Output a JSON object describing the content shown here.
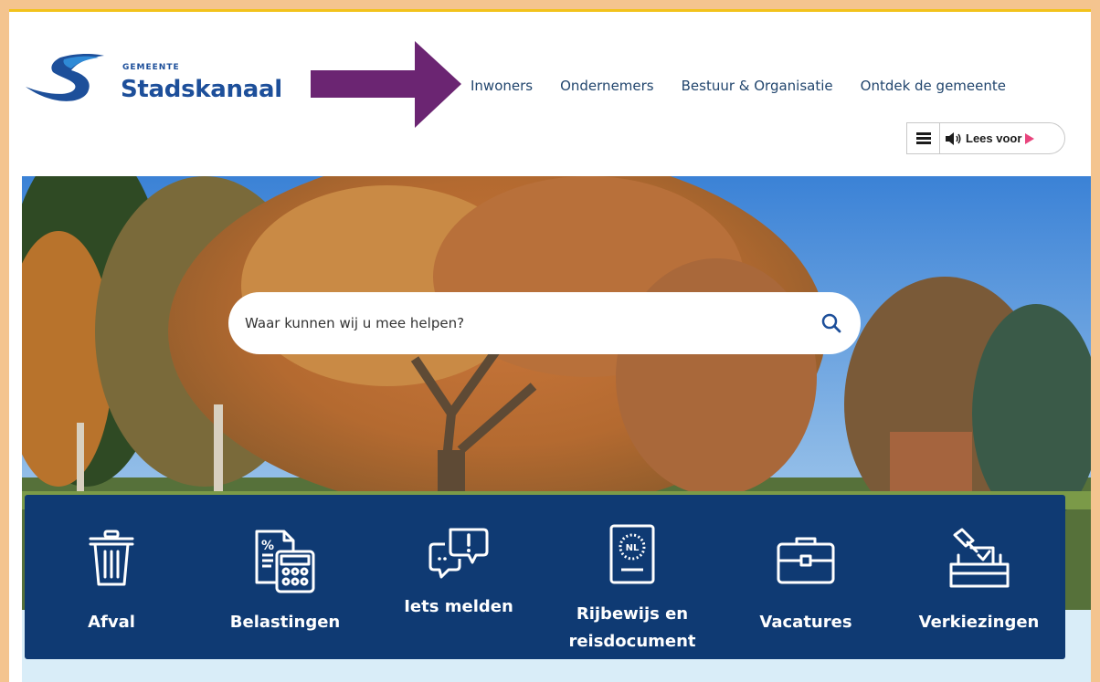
{
  "logo": {
    "small_text": "GEMEENTE",
    "name": "Stadskanaal"
  },
  "nav": {
    "items": [
      "Inwoners",
      "Ondernemers",
      "Bestuur & Organisatie",
      "Ontdek de gemeente"
    ]
  },
  "readspeaker": {
    "label": "Lees voor"
  },
  "search": {
    "placeholder": "Waar kunnen wij u mee helpen?"
  },
  "tiles": [
    {
      "label": "Afval",
      "icon": "trash-bin-icon"
    },
    {
      "label": "Belastingen",
      "icon": "calculator-tax-icon"
    },
    {
      "label": "Iets melden",
      "icon": "speech-bubbles-alert-icon"
    },
    {
      "label_line1": "Rijbewijs en",
      "label_line2": "reisdocument",
      "icon": "passport-nl-icon"
    },
    {
      "label": "Vacatures",
      "icon": "briefcase-icon"
    },
    {
      "label": "Verkiezingen",
      "icon": "ballot-box-icon"
    }
  ],
  "colors": {
    "brand_blue": "#1d4f9a",
    "tiles_bg": "#0f3a73",
    "annotation_arrow": "#6b2572",
    "frame": "#f4c48f"
  }
}
